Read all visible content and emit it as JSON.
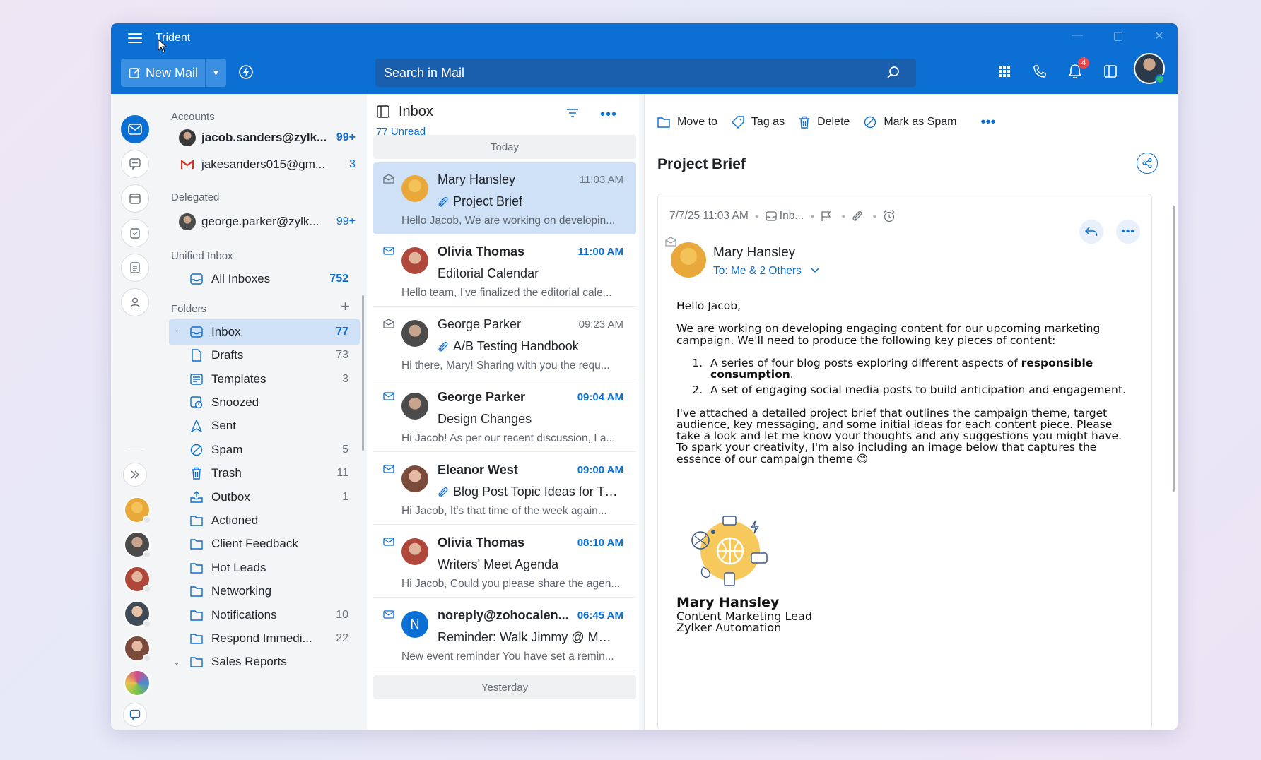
{
  "app": {
    "title": "Trident"
  },
  "toolbar": {
    "new_mail_label": "New Mail",
    "search_placeholder": "Search in Mail",
    "notification_count": "4"
  },
  "folders_pane": {
    "accounts_label": "Accounts",
    "accounts": [
      {
        "name": "jacob.sanders@zylk...",
        "count": "99+"
      },
      {
        "name": "jakesanders015@gm...",
        "count": "3"
      }
    ],
    "delegated_label": "Delegated",
    "delegated": [
      {
        "name": "george.parker@zylk...",
        "count": "99+"
      }
    ],
    "unified_label": "Unified Inbox",
    "all_inboxes": {
      "name": "All Inboxes",
      "count": "752"
    },
    "folders_label": "Folders",
    "folders": [
      {
        "name": "Inbox",
        "count": "77"
      },
      {
        "name": "Drafts",
        "count": "73"
      },
      {
        "name": "Templates",
        "count": "3"
      },
      {
        "name": "Snoozed",
        "count": ""
      },
      {
        "name": "Sent",
        "count": ""
      },
      {
        "name": "Spam",
        "count": "5"
      },
      {
        "name": "Trash",
        "count": "11"
      },
      {
        "name": "Outbox",
        "count": "1"
      },
      {
        "name": "Actioned",
        "count": ""
      },
      {
        "name": "Client Feedback",
        "count": ""
      },
      {
        "name": "Hot Leads",
        "count": ""
      },
      {
        "name": "Networking",
        "count": ""
      },
      {
        "name": "Notifications",
        "count": "10"
      },
      {
        "name": "Respond Immedi...",
        "count": "22"
      },
      {
        "name": "Sales Reports",
        "count": ""
      }
    ]
  },
  "message_list": {
    "title": "Inbox",
    "unread": "77 Unread",
    "today_label": "Today",
    "yesterday_label": "Yesterday",
    "messages": [
      {
        "sender": "Mary Hansley",
        "time": "11:03 AM",
        "subject": "Project Brief",
        "preview": "Hello Jacob, We are working on developin...",
        "attachment": true
      },
      {
        "sender": "Olivia Thomas",
        "time": "11:00 AM",
        "subject": "Editorial Calendar",
        "preview": "Hello team, I've finalized the editorial cale...",
        "attachment": false
      },
      {
        "sender": "George Parker",
        "time": "09:23 AM",
        "subject": "A/B Testing Handbook",
        "preview": "Hi there, Mary! Sharing with you the requ...",
        "attachment": true
      },
      {
        "sender": "George Parker",
        "time": "09:04 AM",
        "subject": "Design Changes",
        "preview": "Hi Jacob! As per our recent discussion, I a...",
        "attachment": false
      },
      {
        "sender": "Eleanor West",
        "time": "09:00 AM",
        "subject": "Blog Post Topic Ideas for Thi...",
        "preview": "Hi Jacob, It's that time of the week again...",
        "attachment": true
      },
      {
        "sender": "Olivia Thomas",
        "time": "08:10 AM",
        "subject": "Writers' Meet Agenda",
        "preview": "Hi Jacob, Could you please share the agen...",
        "attachment": false
      },
      {
        "sender": "noreply@zohocalen...",
        "time": "06:45 AM",
        "subject": "Reminder: Walk Jimmy @ Mon...",
        "preview": "New event reminder You have set a remin...",
        "attachment": false,
        "avatar_letter": "N"
      }
    ]
  },
  "reader": {
    "actions": {
      "move": "Move to",
      "tag": "Tag as",
      "delete": "Delete",
      "spam": "Mark as Spam"
    },
    "subject": "Project Brief",
    "date": "7/7/25 11:03 AM",
    "folder": "Inb...",
    "from": "Mary Hansley",
    "to": "To: Me & 2 Others",
    "greeting": "Hello Jacob,",
    "para1": "We are working on developing engaging content for our upcoming marketing campaign. We'll need to produce the following key pieces of content:",
    "item1_pre": "A series of four blog posts exploring different aspects of ",
    "item1_bold": "responsible consumption",
    "item1_post": ".",
    "item2": "A set of engaging social media posts to build anticipation and engagement.",
    "para2": "I've attached a detailed project brief that outlines the campaign theme, target audience, key messaging, and some initial ideas for each content piece. Please take a look and let me know your thoughts and any suggestions you might have. To spark your creativity, I'm also including an image below that captures the essence of our campaign theme 😊",
    "signature_name": "Mary Hansley",
    "signature_role": "Content Marketing Lead",
    "signature_company": "Zylker Automation"
  },
  "colors": {
    "brand": "#0b6fd4",
    "selected": "#cfe1f7"
  }
}
